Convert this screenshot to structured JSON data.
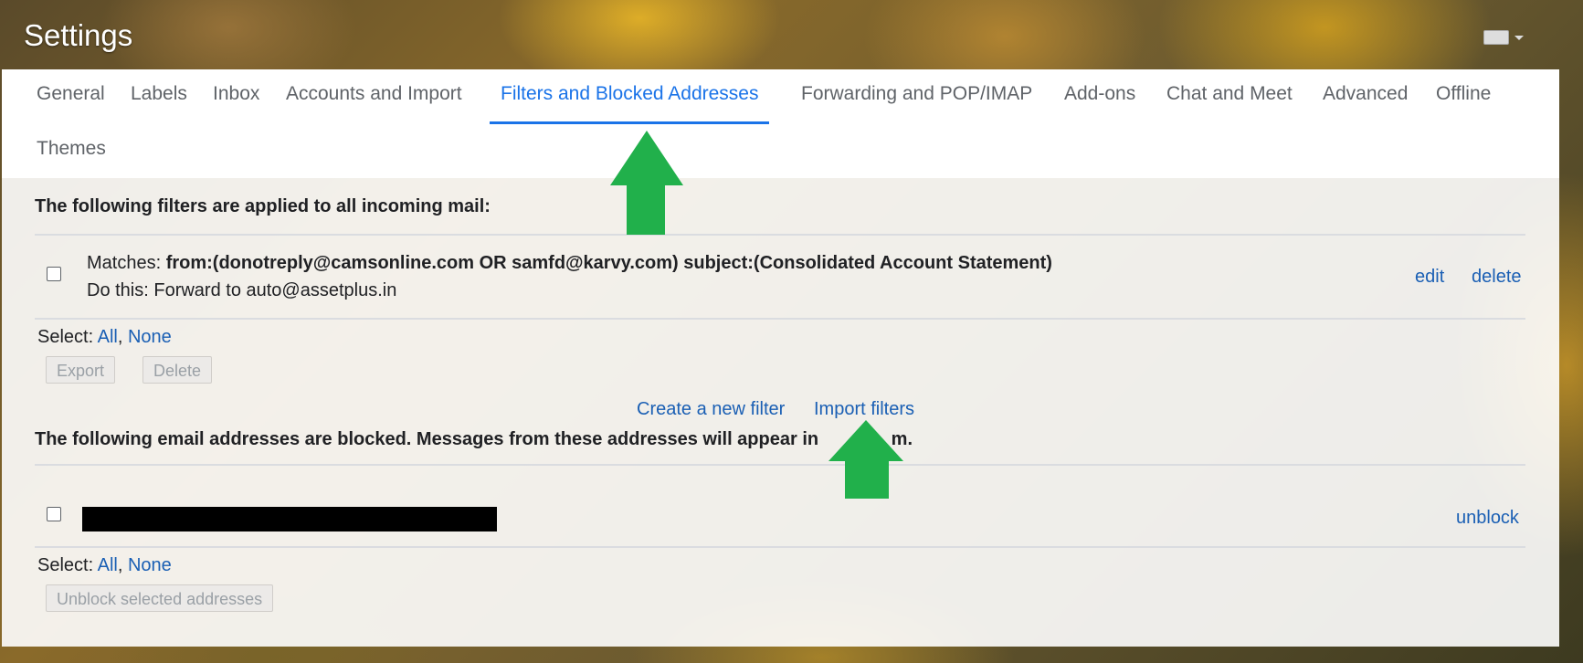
{
  "header": {
    "title": "Settings"
  },
  "tabs": [
    {
      "label": "General"
    },
    {
      "label": "Labels"
    },
    {
      "label": "Inbox"
    },
    {
      "label": "Accounts and Import"
    },
    {
      "label": "Filters and Blocked Addresses",
      "active": true
    },
    {
      "label": "Forwarding and POP/IMAP"
    },
    {
      "label": "Add-ons"
    },
    {
      "label": "Chat and Meet"
    },
    {
      "label": "Advanced"
    },
    {
      "label": "Offline"
    },
    {
      "label": "Themes"
    }
  ],
  "filters": {
    "title": "The following filters are applied to all incoming mail:",
    "item": {
      "matches_label": "Matches: ",
      "matches_value": "from:(donotreply@camsonline.com OR samfd@karvy.com) subject:(Consolidated Account Statement)",
      "do_label": "Do this: ",
      "do_value": "Forward to auto@assetplus.in",
      "edit": "edit",
      "delete": "delete"
    },
    "select_label": "Select: ",
    "select_all": "All",
    "comma": ",",
    "select_none": "None",
    "export_button": "Export",
    "delete_button": "Delete",
    "create_link": "Create a new filter",
    "import_link": "Import filters"
  },
  "blocked": {
    "title_part1": "The following email addresses are blocked. Messages from these addresses will appear in ",
    "title_part2": "m.",
    "unblock": "unblock",
    "select_label": "Select: ",
    "select_all": "All",
    "comma": ",",
    "select_none": "None",
    "unblock_selected_button": "Unblock selected addresses"
  },
  "annotations": {
    "arrow_color": "#21b04b"
  }
}
